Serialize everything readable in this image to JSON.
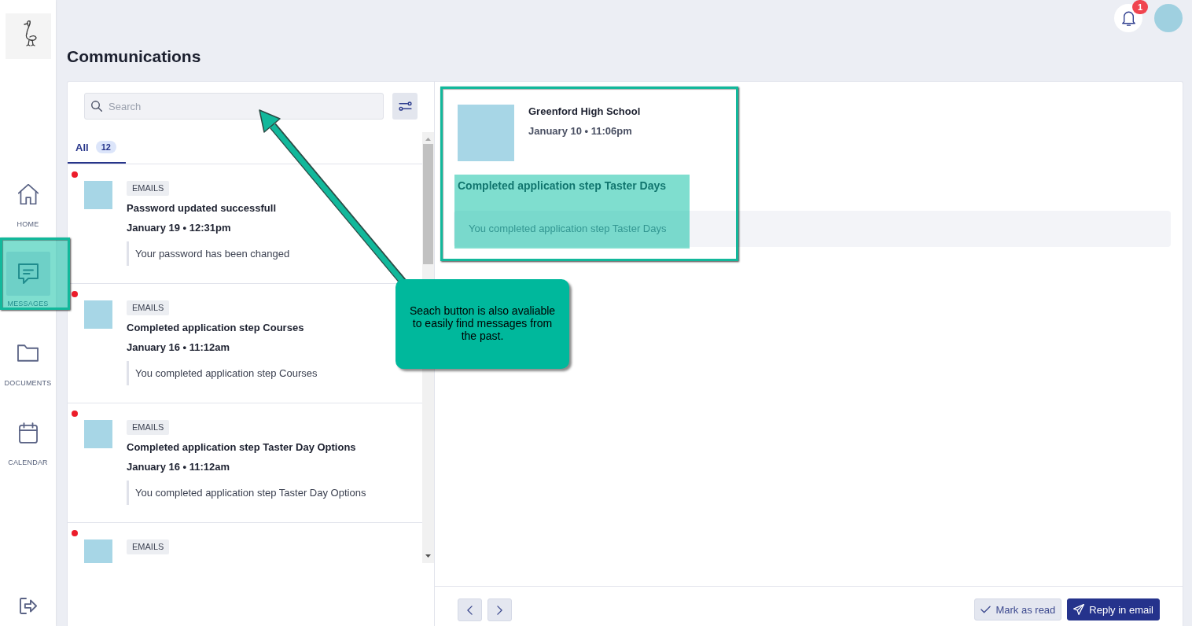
{
  "sidebar": {
    "nav_items": [
      {
        "label": "HOME",
        "selected": false
      },
      {
        "label": "MESSAGES",
        "selected": true
      },
      {
        "label": "DOCUMENTS",
        "selected": false
      },
      {
        "label": "CALENDAR",
        "selected": false
      }
    ]
  },
  "top_bar": {
    "notifications": {
      "count": "1"
    }
  },
  "page_title": "Communications",
  "message_list": {
    "search": {
      "placeholder": "Search"
    },
    "tabs": [
      {
        "label": "All",
        "count": "12",
        "selected": true
      }
    ],
    "messages": [
      {
        "unread": true,
        "tag": "EMAILS",
        "title": "Password updated successfull",
        "date": "January 19 • 12:31pm",
        "preview": "Your password has been changed"
      },
      {
        "unread": true,
        "tag": "EMAILS",
        "title": "Completed application step Courses",
        "date": "January 16 • 11:12am",
        "preview": "You completed application step Courses"
      },
      {
        "unread": true,
        "tag": "EMAILS",
        "title": "Completed application step Taster Day Options",
        "date": "January 16 • 11:12am",
        "preview": "You completed application step Taster Day Options"
      },
      {
        "unread": true,
        "tag": "EMAILS"
      }
    ]
  },
  "message_detail": {
    "sender": "Greenford High School",
    "date": "January 10 • 11:06pm",
    "subject": "Completed application step Taster Days",
    "body": "You completed application step Taster Days"
  },
  "footer": {
    "buttons": [
      {
        "kind": "secondary",
        "label": "Mark as read"
      },
      {
        "kind": "primary",
        "label": "Reply in email"
      }
    ]
  },
  "annotation": {
    "callout": "Seach button is also avaliable to easily find messages from the past."
  }
}
